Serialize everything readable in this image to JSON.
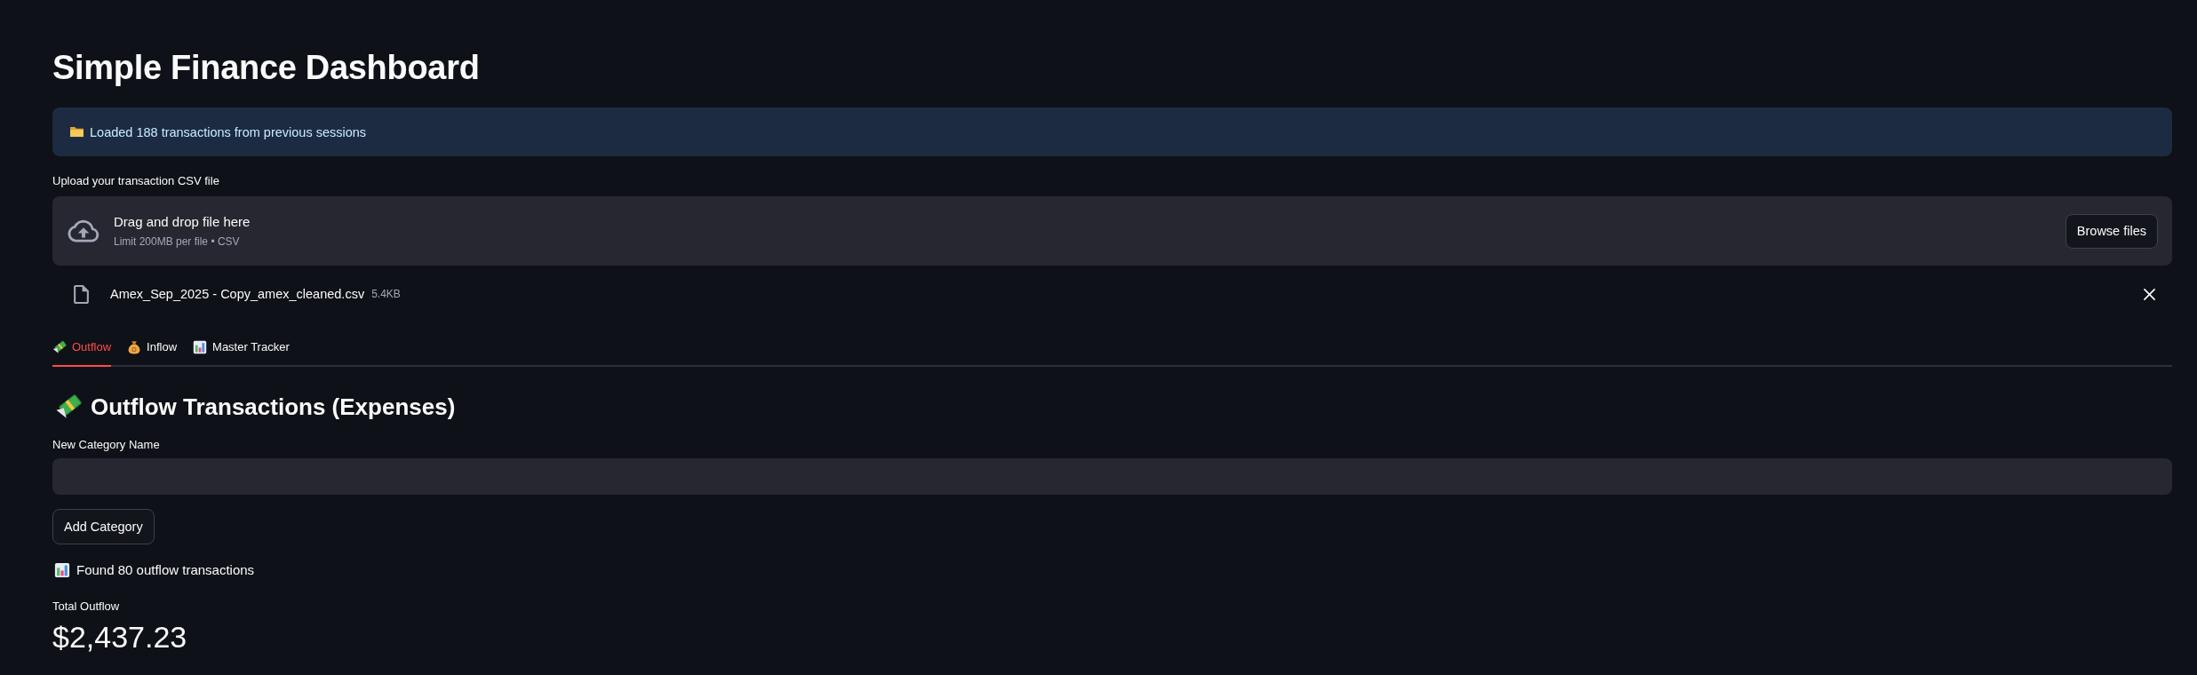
{
  "page": {
    "title": "Simple Finance Dashboard"
  },
  "info_alert": {
    "text": "Loaded 188 transactions from previous sessions"
  },
  "file_uploader": {
    "label": "Upload your transaction CSV file",
    "dropzone_title": "Drag and drop file here",
    "dropzone_hint": "Limit 200MB per file • CSV",
    "browse_button": "Browse files",
    "files": [
      {
        "name": "Amex_Sep_2025 - Copy_amex_cleaned.csv",
        "size": "5.4KB"
      }
    ]
  },
  "tabs": [
    {
      "label": "Outflow",
      "selected": true
    },
    {
      "label": "Inflow",
      "selected": false
    },
    {
      "label": "Master Tracker",
      "selected": false
    }
  ],
  "section": {
    "heading": "Outflow Transactions (Expenses)",
    "category_field": {
      "label": "New Category Name"
    },
    "add_button": "Add Category",
    "found_message": "Found 80 outflow transactions",
    "metric": {
      "label": "Total Outflow",
      "value": "$2,437.23"
    }
  }
}
